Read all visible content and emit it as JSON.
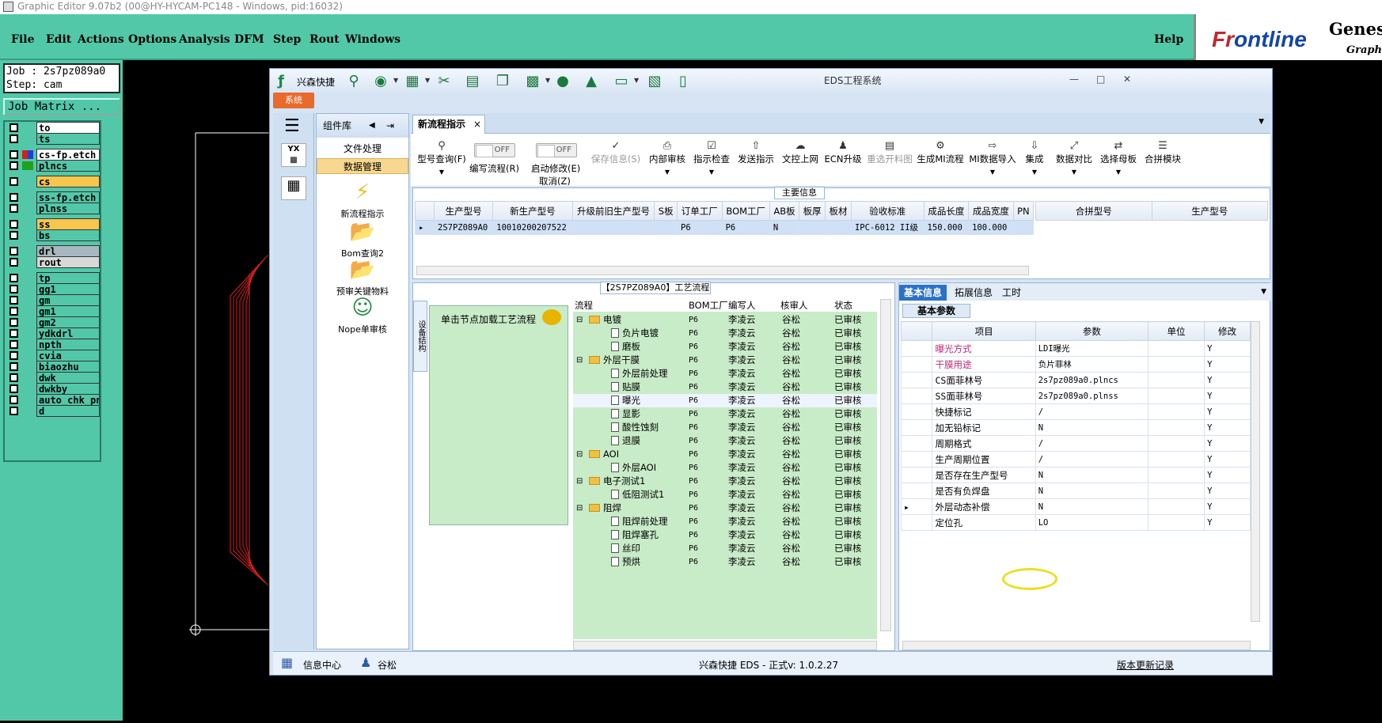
{
  "genesis": {
    "title_bar": "Graphic Editor 9.07b2 (00@HY-HYCAM-PC148 - Windows, pid:16032)",
    "menus": [
      "File",
      "Edit",
      "Actions",
      "Options",
      "Analysis",
      "DFM",
      "Step",
      "Rout",
      "Windows"
    ],
    "help": "Help",
    "logo_frontline_a": "Fr",
    "logo_frontline_b": "ontline",
    "logo_genesis": "Genesi",
    "logo_graphic": "Graphic",
    "job_line": "Job : 2s7pz089a0",
    "step_line": "Step: cam",
    "job_matrix": "Job Matrix ...",
    "layers": [
      {
        "name": "to",
        "color": "#ffffff",
        "swatch": ""
      },
      {
        "name": "ts",
        "color": "#52c8a8",
        "swatch": ""
      },
      {
        "name": "cs-fp.etch",
        "color": "#ffffff",
        "swatch": "red-blue"
      },
      {
        "name": "plncs",
        "color": "#52c8a8",
        "swatch": "green"
      },
      {
        "name": "cs",
        "color": "#f7c64c",
        "swatch": ""
      },
      {
        "name": "ss-fp.etch",
        "color": "#52c8a8",
        "swatch": ""
      },
      {
        "name": "plnss",
        "color": "#52c8a8",
        "swatch": ""
      },
      {
        "name": "ss",
        "color": "#f7c64c",
        "swatch": ""
      },
      {
        "name": "bs",
        "color": "#52c8a8",
        "swatch": ""
      },
      {
        "name": "drl",
        "color": "#a8b8c0",
        "swatch": ""
      },
      {
        "name": "rout",
        "color": "#d8d8d8",
        "swatch": ""
      },
      {
        "name": "tp",
        "color": "#52c8a8",
        "swatch": ""
      },
      {
        "name": "gg1",
        "color": "#52c8a8",
        "swatch": ""
      },
      {
        "name": "gm",
        "color": "#52c8a8",
        "swatch": ""
      },
      {
        "name": "gm1",
        "color": "#52c8a8",
        "swatch": ""
      },
      {
        "name": "gm2",
        "color": "#52c8a8",
        "swatch": ""
      },
      {
        "name": "ydkdrl",
        "color": "#52c8a8",
        "swatch": ""
      },
      {
        "name": "npth",
        "color": "#52c8a8",
        "swatch": ""
      },
      {
        "name": "cvia",
        "color": "#52c8a8",
        "swatch": ""
      },
      {
        "name": "biaozhu",
        "color": "#52c8a8",
        "swatch": ""
      },
      {
        "name": "dwk",
        "color": "#52c8a8",
        "swatch": ""
      },
      {
        "name": "dwkby",
        "color": "#52c8a8",
        "swatch": ""
      },
      {
        "name": "auto_chk_pn",
        "color": "#52c8a8",
        "swatch": ""
      },
      {
        "name": "d",
        "color": "#52c8a8",
        "swatch": ""
      }
    ]
  },
  "eds": {
    "app_name": "兴森快捷",
    "window_title": "EDS工程系统",
    "sys_tab": "系统",
    "component_lib": "组件库",
    "comp_items": {
      "file": "文件处理",
      "data": "数据管理"
    },
    "comp_icons": [
      {
        "label": "新流程指示",
        "icon": "lightning-icon"
      },
      {
        "label": "Bom查询2",
        "icon": "folder-icon"
      },
      {
        "label": "预审关键物料",
        "icon": "folder-icon"
      },
      {
        "label": "Nope单审核",
        "icon": "person-icon"
      }
    ],
    "main_tab": "新流程指示",
    "toolbar": [
      {
        "label": "型号查询(F)",
        "disabled": false
      },
      {
        "label": "保存信息(S)",
        "disabled": true
      },
      {
        "label": "内部审核",
        "disabled": false
      },
      {
        "label": "指示检查",
        "disabled": false
      },
      {
        "label": "发送指示",
        "disabled": false
      },
      {
        "label": "文控上网",
        "disabled": false
      },
      {
        "label": "ECN升级",
        "disabled": false
      },
      {
        "label": "重选开料图",
        "disabled": true
      },
      {
        "label": "生成MI流程",
        "disabled": false
      },
      {
        "label": "MI数据导入",
        "disabled": false
      },
      {
        "label": "集成",
        "disabled": false
      },
      {
        "label": "数据对比",
        "disabled": false
      },
      {
        "label": "选择母板",
        "disabled": false
      },
      {
        "label": "合拼模块",
        "disabled": false
      }
    ],
    "toggle_write": {
      "state": "OFF",
      "label": "编写流程(R)"
    },
    "toggle_start": {
      "state": "OFF",
      "label": "启动修改(E)",
      "label2": "取消(Z)"
    },
    "main_info_caption": "主要信息",
    "main_info_headers": [
      "生产型号",
      "新生产型号",
      "升级前旧生产型号",
      "S板",
      "订单工厂",
      "BOM工厂",
      "AB板",
      "板厚",
      "板材",
      "验收标准",
      "成品长度",
      "成品宽度",
      "PN"
    ],
    "main_info_row": [
      "2S7PZ089A0",
      "10010200207522",
      "",
      "",
      "P6",
      "P6",
      "N",
      "",
      "",
      "IPC-6012 II级",
      "150.000",
      "100.000",
      ""
    ],
    "merge_headers": [
      "合拼型号",
      "生产型号"
    ],
    "proc_caption": "【2S7PZ089A0】工艺流程",
    "vtab_label": "设备结构",
    "load_hint": "单击节点加载工艺流程",
    "tree_headers": [
      "流程",
      "BOM工厂",
      "编写人",
      "核审人",
      "状态"
    ],
    "tree_rows": [
      {
        "name": "电镀",
        "level": 0,
        "folder": true,
        "f": "P6",
        "w": "李凌云",
        "r": "谷松",
        "s": "已审核"
      },
      {
        "name": "负片电镀",
        "level": 1,
        "folder": false,
        "f": "P6",
        "w": "李凌云",
        "r": "谷松",
        "s": "已审核"
      },
      {
        "name": "磨板",
        "level": 1,
        "folder": false,
        "f": "P6",
        "w": "李凌云",
        "r": "谷松",
        "s": "已审核"
      },
      {
        "name": "外层干膜",
        "level": 0,
        "folder": true,
        "f": "P6",
        "w": "李凌云",
        "r": "谷松",
        "s": "已审核"
      },
      {
        "name": "外层前处理",
        "level": 1,
        "folder": false,
        "f": "P6",
        "w": "李凌云",
        "r": "谷松",
        "s": "已审核"
      },
      {
        "name": "贴膜",
        "level": 1,
        "folder": false,
        "f": "P6",
        "w": "李凌云",
        "r": "谷松",
        "s": "已审核"
      },
      {
        "name": "曝光",
        "level": 1,
        "folder": false,
        "f": "P6",
        "w": "李凌云",
        "r": "谷松",
        "s": "已审核"
      },
      {
        "name": "显影",
        "level": 1,
        "folder": false,
        "f": "P6",
        "w": "李凌云",
        "r": "谷松",
        "s": "已审核"
      },
      {
        "name": "酸性蚀刻",
        "level": 1,
        "folder": false,
        "f": "P6",
        "w": "李凌云",
        "r": "谷松",
        "s": "已审核"
      },
      {
        "name": "退膜",
        "level": 1,
        "folder": false,
        "f": "P6",
        "w": "李凌云",
        "r": "谷松",
        "s": "已审核"
      },
      {
        "name": "AOI",
        "level": 0,
        "folder": true,
        "f": "P6",
        "w": "李凌云",
        "r": "谷松",
        "s": "已审核"
      },
      {
        "name": "外层AOI",
        "level": 1,
        "folder": false,
        "f": "P6",
        "w": "李凌云",
        "r": "谷松",
        "s": "已审核"
      },
      {
        "name": "电子测试1",
        "level": 0,
        "folder": true,
        "f": "P6",
        "w": "李凌云",
        "r": "谷松",
        "s": "已审核"
      },
      {
        "name": "低阻测试1",
        "level": 1,
        "folder": false,
        "f": "P6",
        "w": "李凌云",
        "r": "谷松",
        "s": "已审核"
      },
      {
        "name": "阻焊",
        "level": 0,
        "folder": true,
        "f": "P6",
        "w": "李凌云",
        "r": "谷松",
        "s": "已审核"
      },
      {
        "name": "阻焊前处理",
        "level": 1,
        "folder": false,
        "f": "P6",
        "w": "李凌云",
        "r": "谷松",
        "s": "已审核"
      },
      {
        "name": "阻焊塞孔",
        "level": 1,
        "folder": false,
        "f": "P6",
        "w": "李凌云",
        "r": "谷松",
        "s": "已审核"
      },
      {
        "name": "丝印",
        "level": 1,
        "folder": false,
        "f": "P6",
        "w": "李凌云",
        "r": "谷松",
        "s": "已审核"
      },
      {
        "name": "预烘",
        "level": 1,
        "folder": false,
        "f": "P6",
        "w": "李凌云",
        "r": "谷松",
        "s": "已审核"
      }
    ],
    "param_tabs": [
      "基本信息",
      "拓展信息",
      "工时"
    ],
    "param_basic": "基本参数",
    "param_headers": [
      "项目",
      "参数",
      "单位",
      "修改"
    ],
    "params": [
      {
        "k": "曝光方式",
        "v": "LDI曝光",
        "u": "",
        "m": "Y",
        "pink": true
      },
      {
        "k": "干膜用途",
        "v": "负片菲林",
        "u": "",
        "m": "Y",
        "pink": true
      },
      {
        "k": "CS面菲林号",
        "v": "2s7pz089a0.plncs",
        "u": "",
        "m": "Y",
        "pink": false
      },
      {
        "k": "SS面菲林号",
        "v": "2s7pz089a0.plnss",
        "u": "",
        "m": "Y",
        "pink": false
      },
      {
        "k": "快捷标记",
        "v": "/",
        "u": "",
        "m": "Y",
        "pink": false
      },
      {
        "k": "加无铅标记",
        "v": "N",
        "u": "",
        "m": "Y",
        "pink": false
      },
      {
        "k": "周期格式",
        "v": "/",
        "u": "",
        "m": "Y",
        "pink": false
      },
      {
        "k": "生产周期位置",
        "v": "/",
        "u": "",
        "m": "Y",
        "pink": false
      },
      {
        "k": "是否存在生产型号",
        "v": "N",
        "u": "",
        "m": "Y",
        "pink": false
      },
      {
        "k": "是否有负焊盘",
        "v": "N",
        "u": "",
        "m": "Y",
        "pink": false
      },
      {
        "k": "外层动态补偿",
        "v": "N",
        "u": "",
        "m": "Y",
        "pink": false
      },
      {
        "k": "定位孔",
        "v": "LO",
        "u": "",
        "m": "Y",
        "pink": false
      }
    ],
    "status": {
      "info_center": "信息中心",
      "user": "谷松",
      "version": "兴森快捷 EDS - 正式v: 1.0.2.27",
      "changelog": "版本更新记录"
    }
  }
}
